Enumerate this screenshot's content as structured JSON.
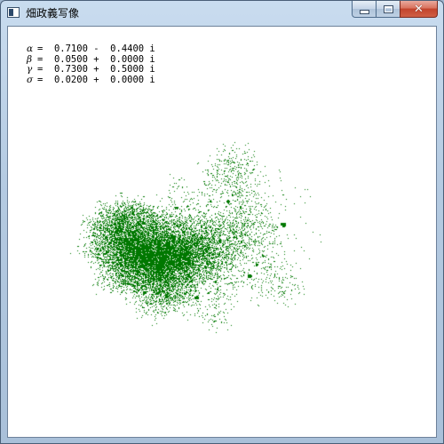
{
  "window": {
    "title": "畑政義写像",
    "icon": "app-window-icon",
    "buttons": {
      "minimize_icon": "minimize-icon",
      "maximize_icon": "maximize-icon",
      "close_label": "✕"
    }
  },
  "parameters": [
    {
      "symbol": "α",
      "value": "=  0.7100 -  0.4400 i"
    },
    {
      "symbol": "β",
      "value": "=  0.0500 +  0.0000 i"
    },
    {
      "symbol": "γ",
      "value": "=  0.7300 +  0.5000 i"
    },
    {
      "symbol": "σ",
      "value": "=  0.0200 +  0.0000 i"
    }
  ],
  "plot": {
    "point_color": "#007800",
    "background": "#ffffff"
  }
}
